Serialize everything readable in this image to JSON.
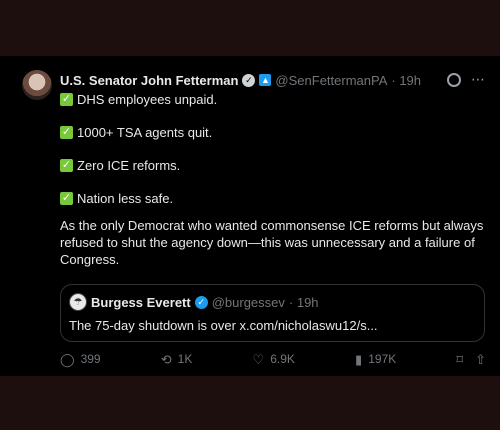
{
  "tweet": {
    "author_name": "U.S. Senator John Fetterman",
    "handle": "@SenFettermanPA",
    "time": "· 19h",
    "checks": [
      "DHS employees unpaid.",
      "1000+ TSA agents quit.",
      "Zero ICE reforms.",
      "Nation less safe."
    ],
    "paragraph": "As the only Democrat who wanted commonsense ICE reforms but always refused to shut the agency down—this was unnecessary and a failure of Congress."
  },
  "quote": {
    "author_name": "Burgess Everett",
    "handle": "@burgessev",
    "time": "· 19h",
    "text": "The 75-day shutdown is over x.com/nicholaswu12/s..."
  },
  "actions": {
    "replies": "399",
    "reposts": "1K",
    "likes": "6.9K",
    "views": "197K"
  },
  "colors": {
    "accent": "#1d9bf0",
    "muted": "#71767b",
    "check": "#78c93a",
    "bg": "#000000"
  }
}
